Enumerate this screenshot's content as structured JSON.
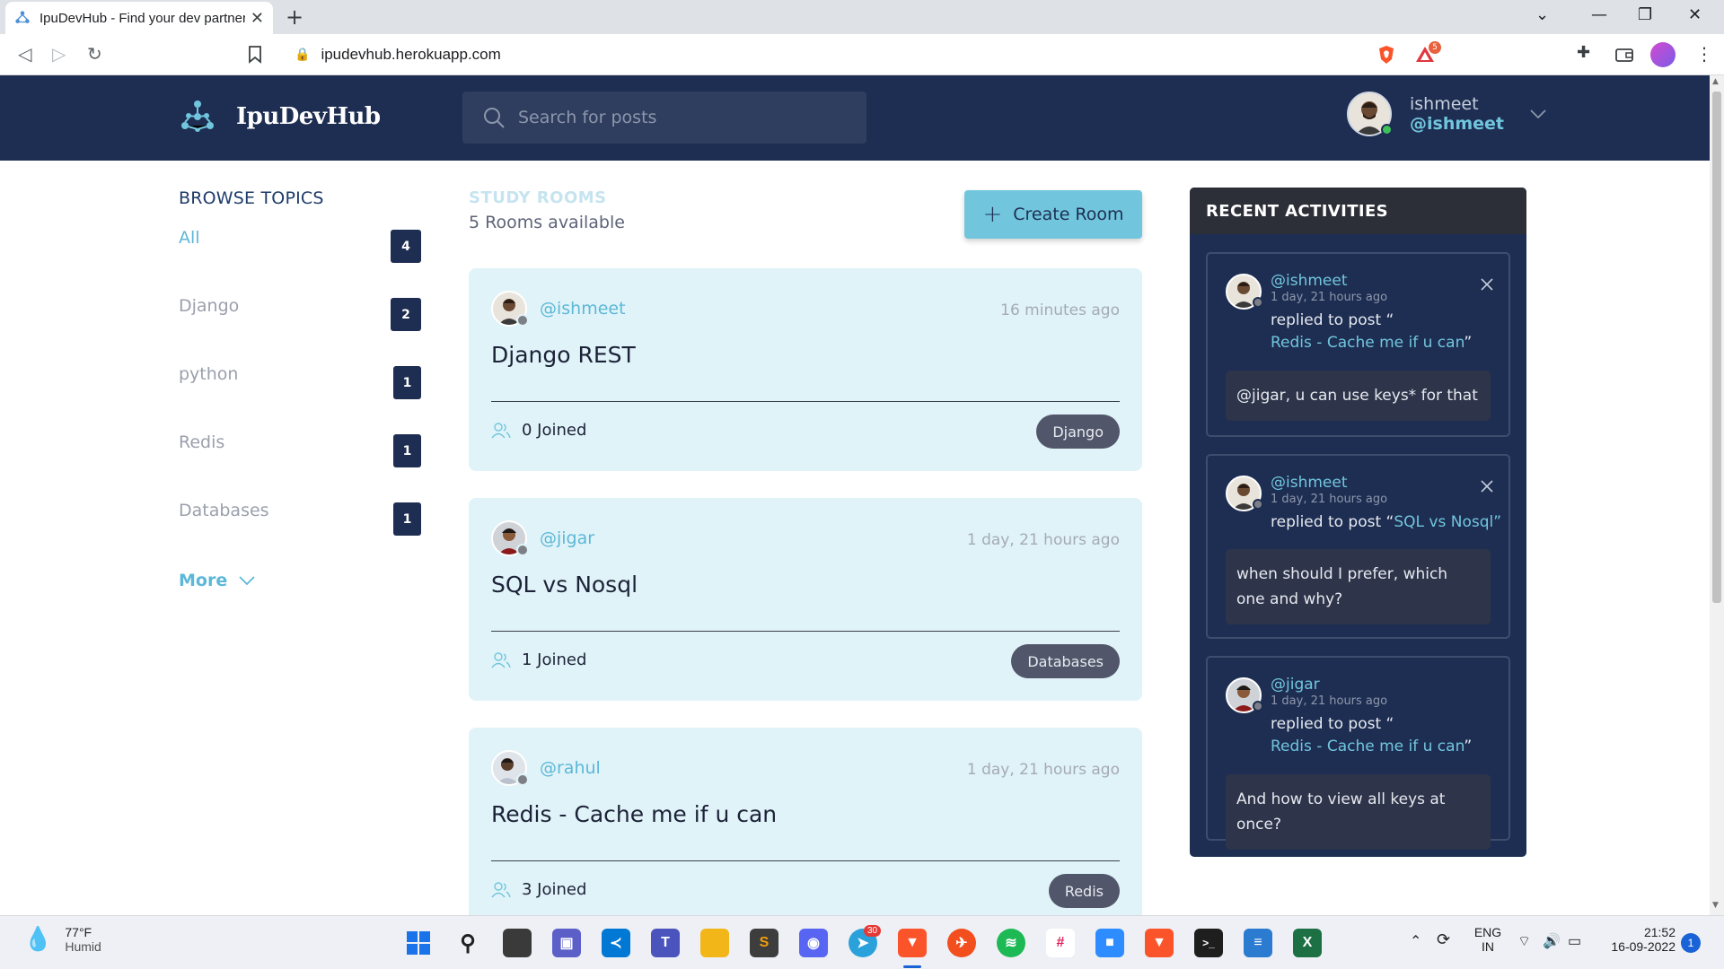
{
  "browser": {
    "tab_title": "IpuDevHub - Find your dev partner",
    "url": "ipudevhub.herokuapp.com",
    "shield_badge": "5"
  },
  "header": {
    "brand": "IpuDevHub",
    "search_placeholder": "Search for posts",
    "user_name": "ishmeet",
    "user_handle": "@ishmeet"
  },
  "topics": {
    "title": "BROWSE TOPICS",
    "items": [
      {
        "name": "All",
        "count": "4"
      },
      {
        "name": "Django",
        "count": "2"
      },
      {
        "name": "python",
        "count": "1"
      },
      {
        "name": "Redis",
        "count": "1"
      },
      {
        "name": "Databases",
        "count": "1"
      }
    ],
    "more_label": "More"
  },
  "rooms": {
    "title": "STUDY ROOMS",
    "count_text": "5 Rooms available",
    "create_label": "Create Room",
    "items": [
      {
        "host": "@ishmeet",
        "time": "16 minutes ago",
        "title": "Django REST",
        "joined": "0 Joined",
        "topic": "Django"
      },
      {
        "host": "@jigar",
        "time": "1 day, 21 hours ago",
        "title": "SQL vs Nosql",
        "joined": "1 Joined",
        "topic": "Databases"
      },
      {
        "host": "@rahul",
        "time": "1 day, 21 hours ago",
        "title": "Redis - Cache me if u can",
        "joined": "3 Joined",
        "topic": "Redis"
      }
    ]
  },
  "activities": {
    "title": "RECENT ACTIVITIES",
    "items": [
      {
        "user": "@ishmeet",
        "time": "1 day, 21 hours ago",
        "action": "replied to post “",
        "post": "Redis - Cache me if u can",
        "close_quote": "”",
        "message": "@jigar, u can use keys* for that"
      },
      {
        "user": "@ishmeet",
        "time": "1 day, 21 hours ago",
        "action": "replied to post “",
        "post": "SQL vs Nosql",
        "close_quote": "”",
        "message": "when should I prefer, which one and why?"
      },
      {
        "user": "@jigar",
        "time": "1 day, 21 hours ago",
        "action": "replied to post “",
        "post": "Redis - Cache me if u can",
        "close_quote": "”",
        "message": "And how to view all keys at once?"
      }
    ]
  },
  "taskbar": {
    "temperature": "77°F",
    "weather": "Humid",
    "telegram_badge": "30",
    "lang": "ENG",
    "region": "IN",
    "time": "21:52",
    "date": "16-09-2022",
    "notifications": "1"
  },
  "colors": {
    "header_bg": "#1e2e52",
    "accent": "#71c6dd",
    "card_bg": "#e0f3f8",
    "topic_badge": "#1e2e52"
  }
}
